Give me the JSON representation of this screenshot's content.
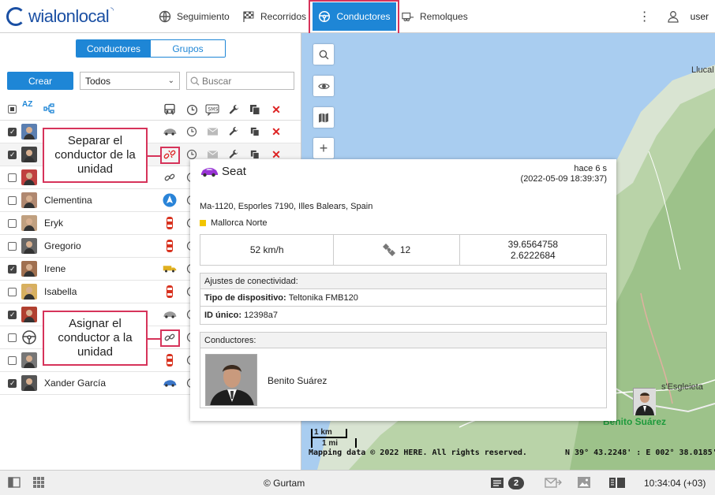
{
  "app": {
    "logo_text": "wialonlocal"
  },
  "nav": {
    "tracking": "Seguimiento",
    "routes": "Recorridos",
    "drivers": "Conductores",
    "trailers": "Remolques",
    "user": "user"
  },
  "panel": {
    "tab_drivers": "Conductores",
    "tab_groups": "Grupos",
    "create": "Crear",
    "filter_value": "Todos",
    "search_placeholder": "Buscar",
    "sort_label": "AZ",
    "rows": [
      {
        "name": "",
        "checked": true
      },
      {
        "name": "",
        "checked": true
      },
      {
        "name": "",
        "checked": false
      },
      {
        "name": "Clementina",
        "checked": false
      },
      {
        "name": "Eryk",
        "checked": false
      },
      {
        "name": "Gregorio",
        "checked": false
      },
      {
        "name": "Irene",
        "checked": true
      },
      {
        "name": "Isabella",
        "checked": false
      },
      {
        "name": "",
        "checked": true
      },
      {
        "name": "",
        "checked": false
      },
      {
        "name": "",
        "checked": false
      },
      {
        "name": "Xander García",
        "checked": true
      }
    ]
  },
  "callouts": {
    "detach": "Separar el conductor de la unidad",
    "assign": "Asignar el conductor a la unidad"
  },
  "popup": {
    "unit_name": "Seat",
    "ago": "hace 6 s",
    "datetime": "(2022-05-09 18:39:37)",
    "address": "Ma-1120, Esporles 7190, Illes Balears, Spain",
    "geofence": "Mallorca Norte",
    "speed": "52 km/h",
    "satellites": "12",
    "lat": "39.6564758",
    "lon": "2.6222684",
    "connectivity_title": "Ajustes de conectividad:",
    "device_label": "Tipo de dispositivo:",
    "device_value": "Teltonika FMB120",
    "uid_label": "ID único:",
    "uid_value": "12398a7",
    "drivers_title": "Conductores:",
    "driver_name": "Benito Suárez"
  },
  "map": {
    "place_llucal": "Llucal",
    "place_esglaieta": "s'Esgleieta",
    "driver_label": "Benito Suárez",
    "scale_km": "1 km",
    "scale_mi": "1 mi",
    "copyright": "Mapping data © 2022 HERE. All rights reserved.",
    "coords": "N 39° 43.2248' : E 002° 38.0185'"
  },
  "bottom": {
    "brand": "© Gurtam",
    "notifications": "2",
    "clock": "10:34:04 (+03)"
  },
  "colors": {
    "accent": "#1e86d6",
    "callout": "#d6335a"
  }
}
